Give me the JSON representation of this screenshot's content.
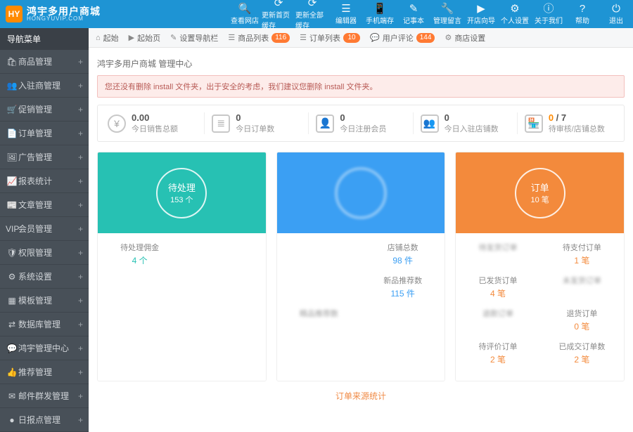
{
  "brand": {
    "badge": "HY",
    "name": "鸿宇多用户商城",
    "sub": "HONGYUVIP.COM"
  },
  "topIcons": [
    {
      "glyph": "🔍",
      "label": "查看网店"
    },
    {
      "glyph": "⟳",
      "label": "更新首页缓存"
    },
    {
      "glyph": "⟳",
      "label": "更新全部缓存"
    },
    {
      "glyph": "☰",
      "label": "编辑器"
    },
    {
      "glyph": "📱",
      "label": "手机端存"
    },
    {
      "glyph": "✎",
      "label": "记事本"
    },
    {
      "glyph": "🔧",
      "label": "管理留言"
    },
    {
      "glyph": "▶",
      "label": "开店向导"
    },
    {
      "glyph": "⚙",
      "label": "个人设置"
    },
    {
      "glyph": "ⓘ",
      "label": "关于我们"
    },
    {
      "glyph": "?",
      "label": "帮助"
    },
    {
      "glyph": "⏻",
      "label": "退出"
    }
  ],
  "toolbar": {
    "items": [
      {
        "icon": "⌂",
        "label": "起始"
      },
      {
        "icon": "▶",
        "label": "起始页"
      },
      {
        "icon": "✎",
        "label": "设置导航栏"
      },
      {
        "icon": "☰",
        "label": "商品列表",
        "badge": "116"
      },
      {
        "icon": "☰",
        "label": "订单列表",
        "badge": "10"
      },
      {
        "icon": "💬",
        "label": "用户评论",
        "badge": "144"
      },
      {
        "icon": "⚙",
        "label": "商店设置"
      }
    ]
  },
  "sidebar": {
    "title": "导航菜单",
    "items": [
      {
        "icon": "🛍",
        "label": "商品管理"
      },
      {
        "icon": "👥",
        "label": "入驻商管理"
      },
      {
        "icon": "🛒",
        "label": "促销管理"
      },
      {
        "icon": "📄",
        "label": "订单管理"
      },
      {
        "icon": "🖼",
        "label": "广告管理"
      },
      {
        "icon": "📈",
        "label": "报表统计"
      },
      {
        "icon": "📰",
        "label": "文章管理"
      },
      {
        "icon": "VIP",
        "label": "会员管理"
      },
      {
        "icon": "🛡",
        "label": "权限管理"
      },
      {
        "icon": "⚙",
        "label": "系统设置"
      },
      {
        "icon": "▦",
        "label": "模板管理"
      },
      {
        "icon": "⇄",
        "label": "数据库管理"
      },
      {
        "icon": "💬",
        "label": "鸿宇管理中心"
      },
      {
        "icon": "👍",
        "label": "推荐管理"
      },
      {
        "icon": "✉",
        "label": "邮件群发管理"
      },
      {
        "icon": "●",
        "label": "日报点管理"
      }
    ]
  },
  "crumb": "鸿宇多用户商城 管理中心",
  "alert": "您还没有删除 install 文件夹，出于安全的考虑，我们建议您删除 install 文件夹。",
  "stats": [
    {
      "icon": "¥",
      "shape": "round",
      "value": "0.00",
      "label": "今日销售总额"
    },
    {
      "icon": "≣",
      "shape": "sq",
      "value": "0",
      "label": "今日订单数"
    },
    {
      "icon": "👤",
      "shape": "sq",
      "value": "0",
      "label": "今日注册会员"
    },
    {
      "icon": "👥",
      "shape": "sq",
      "value": "0",
      "label": "今日入驻店铺数"
    },
    {
      "icon": "🏪",
      "shape": "sq",
      "valueRich": {
        "a": "0",
        "sep": " / ",
        "b": "7"
      },
      "label": "待审核/店铺总数"
    }
  ],
  "cards": {
    "teal": {
      "title": "待处理",
      "sub": "153 个",
      "cells": [
        {
          "name": "待处理佣金",
          "val": "4 个"
        },
        {
          "name": "",
          "val": ""
        },
        {
          "name": "",
          "val": ""
        },
        {
          "name": "",
          "val": ""
        },
        {
          "name": "",
          "val": ""
        },
        {
          "name": "",
          "val": ""
        },
        {
          "name": "",
          "val": ""
        },
        {
          "name": "",
          "val": ""
        }
      ]
    },
    "blue": {
      "title": "",
      "sub": "",
      "cells": [
        {
          "name": "",
          "val": ""
        },
        {
          "name": "店铺总数",
          "val": "98 件"
        },
        {
          "name": "",
          "val": ""
        },
        {
          "name": "新品推荐数",
          "val": "115 件"
        },
        {
          "name": "精品推荐数",
          "val": ""
        },
        {
          "name": "",
          "val": ""
        },
        {
          "name": "",
          "val": ""
        },
        {
          "name": "",
          "val": ""
        }
      ]
    },
    "orange": {
      "title": "订单",
      "sub": "10 笔",
      "cells": [
        {
          "name": "待发货订单",
          "val": ""
        },
        {
          "name": "待支付订单",
          "val": "1 笔"
        },
        {
          "name": "已发货订单",
          "val": "4 笔"
        },
        {
          "name": "未发货订单",
          "val": ""
        },
        {
          "name": "退款订单",
          "val": ""
        },
        {
          "name": "退货订单",
          "val": "0 笔"
        },
        {
          "name": "待评价订单",
          "val": "2 笔"
        },
        {
          "name": "已成交订单数",
          "val": "2 笔"
        }
      ]
    }
  },
  "chartTitle": "订单来源统计"
}
